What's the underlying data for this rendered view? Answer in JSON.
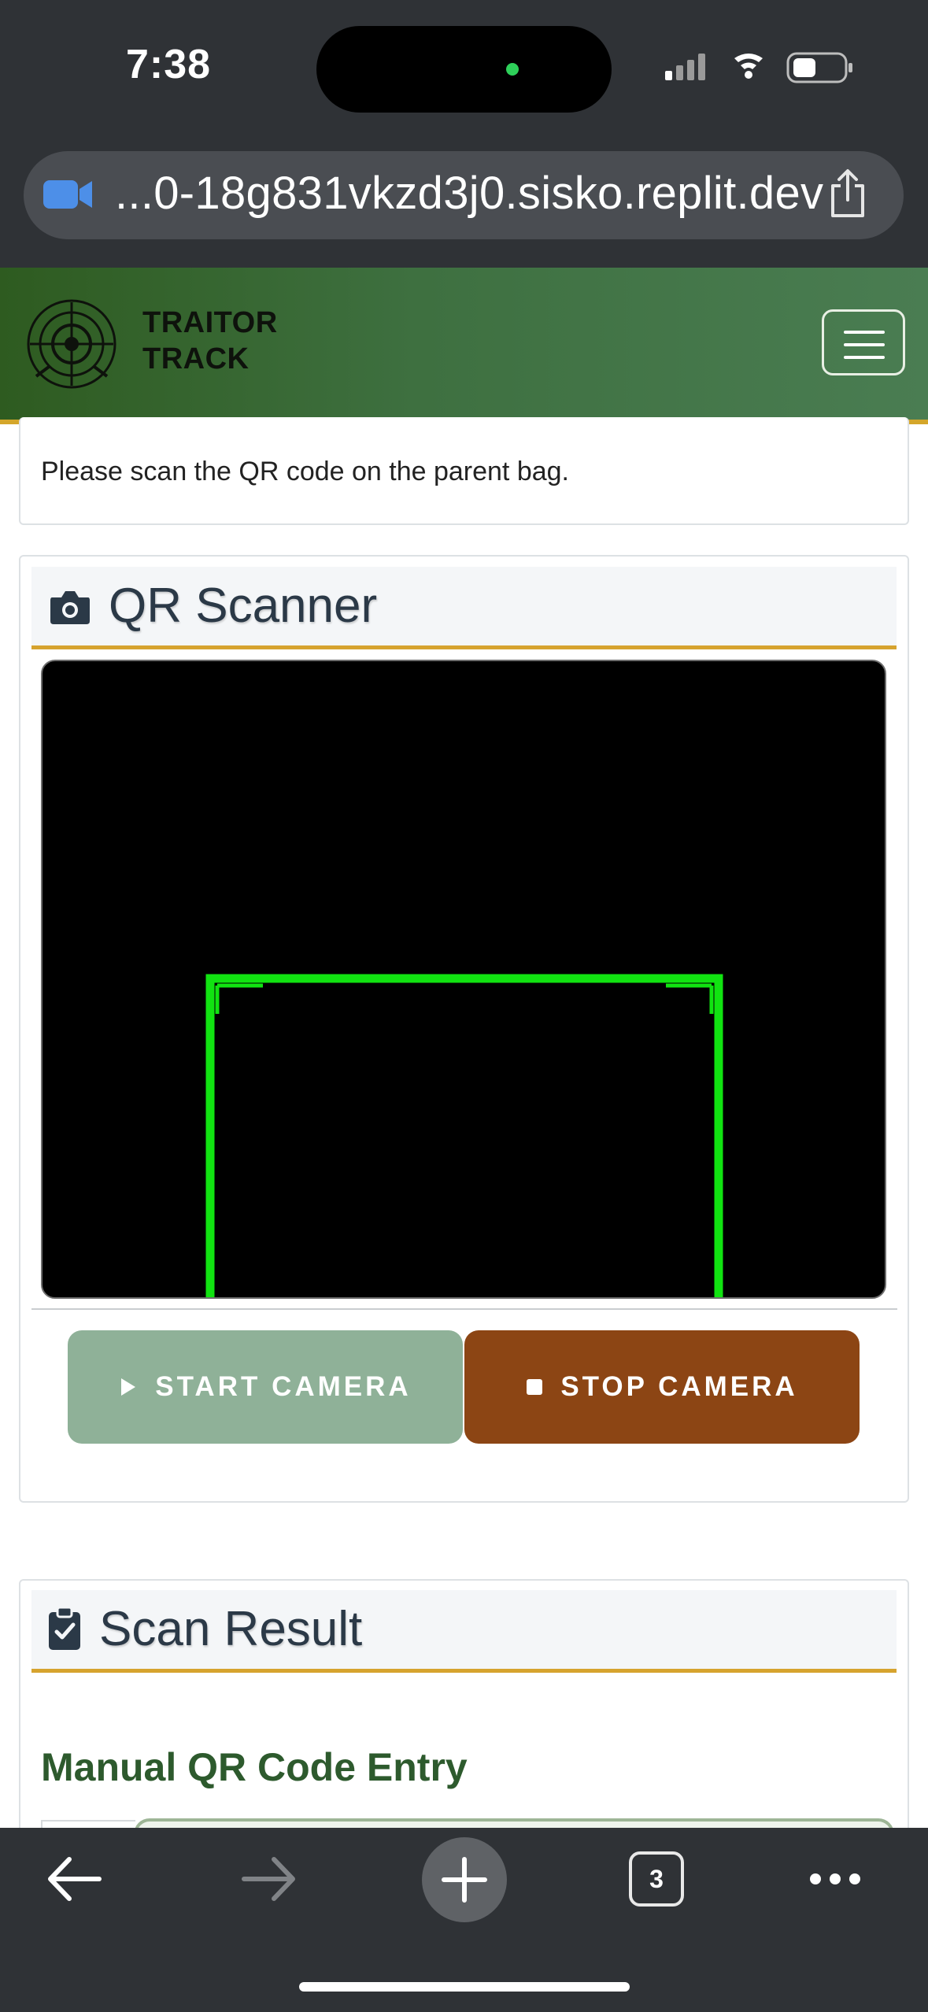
{
  "status_bar": {
    "time": "7:38"
  },
  "browser": {
    "url": "...0-18g831vkzd3j0.sisko.replit.dev",
    "tab_count": "3"
  },
  "app": {
    "brand_line1": "TRAITOR",
    "brand_line2": "TRACK",
    "accent_color": "#d6a32e",
    "nav_color": "#3e7040"
  },
  "instruction": {
    "text": "Please scan the QR code on the parent bag."
  },
  "scanner": {
    "title": "QR Scanner",
    "start_label": "START CAMERA",
    "stop_label": "STOP CAMERA"
  },
  "result": {
    "title": "Scan Result",
    "manual_title": "Manual QR Code Entry"
  }
}
